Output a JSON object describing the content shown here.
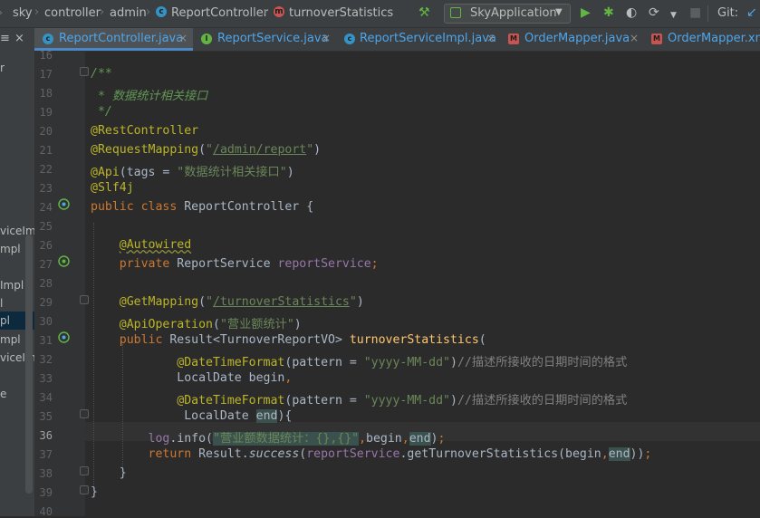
{
  "navbar": {
    "crumbs": [
      "sky",
      "controller",
      "admin",
      "ReportController",
      "turnoverStatistics"
    ],
    "run_config": "SkyApplication",
    "git_label": "Git:"
  },
  "tabs": [
    {
      "label": "ReportController.java",
      "icon": "class-icon",
      "color": "#3592c4"
    },
    {
      "label": "ReportService.java",
      "icon": "interface-icon",
      "color": "#62b543"
    },
    {
      "label": "ReportServiceImpl.java",
      "icon": "class-icon",
      "color": "#3592c4"
    },
    {
      "label": "OrderMapper.java",
      "icon": "mapper-icon",
      "color": "#c75450"
    },
    {
      "label": "OrderMapper.xm",
      "icon": "mapper-icon",
      "color": "#c75450"
    }
  ],
  "project_panel": {
    "items": [
      "r",
      "viceIm",
      "mpl",
      "Impl",
      "l",
      "pl",
      "mpl",
      "viceIm",
      "e"
    ],
    "selected_index": 5
  },
  "editor": {
    "current_line": 36,
    "lines": [
      {
        "n": "16",
        "t": [
          {
            "c": "#629755",
            "s": "",
            "i": true
          }
        ]
      },
      {
        "n": "17",
        "t": [
          {
            "c": "#629755",
            "s": "/**",
            "i": true
          }
        ]
      },
      {
        "n": "18",
        "t": [
          {
            "c": "#629755",
            "s": " * 数据统计相关接口",
            "i": true
          }
        ]
      },
      {
        "n": "19",
        "t": [
          {
            "c": "#629755",
            "s": " */",
            "i": true
          }
        ]
      },
      {
        "n": "20",
        "t": [
          {
            "c": "#bbb529",
            "s": "@RestController"
          }
        ]
      },
      {
        "n": "21",
        "t": [
          {
            "c": "#bbb529",
            "s": "@RequestMapping"
          },
          {
            "c": "#a9b7c6",
            "s": "("
          },
          {
            "c": "#6a8759",
            "s": "\""
          },
          {
            "c": "#6a8759",
            "s": "/admin/report",
            "u": true
          },
          {
            "c": "#6a8759",
            "s": "\""
          },
          {
            "c": "#a9b7c6",
            "s": ")"
          }
        ]
      },
      {
        "n": "22",
        "t": [
          {
            "c": "#bbb529",
            "s": "@Api"
          },
          {
            "c": "#a9b7c6",
            "s": "(tags = "
          },
          {
            "c": "#6a8759",
            "s": "\"数据统计相关接口\""
          },
          {
            "c": "#a9b7c6",
            "s": ")"
          }
        ]
      },
      {
        "n": "23",
        "t": [
          {
            "c": "#bbb529",
            "s": "@Slf4j"
          }
        ]
      },
      {
        "n": "24",
        "t": [
          {
            "c": "#cc7832",
            "s": "public class "
          },
          {
            "c": "#a9b7c6",
            "s": "ReportController {"
          }
        ]
      },
      {
        "n": "25",
        "t": []
      },
      {
        "n": "26",
        "t": [
          {
            "c": "#a9b7c6",
            "s": "    "
          },
          {
            "c": "#bbb529",
            "s": "@Autowired",
            "w": true
          }
        ]
      },
      {
        "n": "27",
        "t": [
          {
            "c": "#a9b7c6",
            "s": "    "
          },
          {
            "c": "#cc7832",
            "s": "private "
          },
          {
            "c": "#a9b7c6",
            "s": "ReportService "
          },
          {
            "c": "#9876aa",
            "s": "reportService"
          },
          {
            "c": "#cc7832",
            "s": ";"
          }
        ]
      },
      {
        "n": "28",
        "t": []
      },
      {
        "n": "29",
        "t": [
          {
            "c": "#a9b7c6",
            "s": "    "
          },
          {
            "c": "#bbb529",
            "s": "@GetMapping"
          },
          {
            "c": "#a9b7c6",
            "s": "("
          },
          {
            "c": "#6a8759",
            "s": "\""
          },
          {
            "c": "#6a8759",
            "s": "/turnoverStatistics",
            "u": true
          },
          {
            "c": "#6a8759",
            "s": "\""
          },
          {
            "c": "#a9b7c6",
            "s": ")"
          }
        ]
      },
      {
        "n": "30",
        "t": [
          {
            "c": "#a9b7c6",
            "s": "    "
          },
          {
            "c": "#bbb529",
            "s": "@ApiOperation"
          },
          {
            "c": "#a9b7c6",
            "s": "("
          },
          {
            "c": "#6a8759",
            "s": "\"营业额统计\""
          },
          {
            "c": "#a9b7c6",
            "s": ")"
          }
        ]
      },
      {
        "n": "31",
        "t": [
          {
            "c": "#a9b7c6",
            "s": "    "
          },
          {
            "c": "#cc7832",
            "s": "public "
          },
          {
            "c": "#a9b7c6",
            "s": "Result<TurnoverReportVO> "
          },
          {
            "c": "#ffc66d",
            "s": "turnoverStatistics"
          },
          {
            "c": "#a9b7c6",
            "s": "("
          }
        ]
      },
      {
        "n": "32",
        "t": [
          {
            "c": "#a9b7c6",
            "s": "            "
          },
          {
            "c": "#bbb529",
            "s": "@DateTimeFormat"
          },
          {
            "c": "#a9b7c6",
            "s": "(pattern = "
          },
          {
            "c": "#6a8759",
            "s": "\"yyyy-MM-dd\""
          },
          {
            "c": "#a9b7c6",
            "s": ")"
          },
          {
            "c": "#808080",
            "s": "//描述所接收的日期时间的格式"
          }
        ]
      },
      {
        "n": "33",
        "t": [
          {
            "c": "#a9b7c6",
            "s": "            LocalDate begin"
          },
          {
            "c": "#cc7832",
            "s": ","
          }
        ]
      },
      {
        "n": "34",
        "t": [
          {
            "c": "#a9b7c6",
            "s": "            "
          },
          {
            "c": "#bbb529",
            "s": "@DateTimeFormat"
          },
          {
            "c": "#a9b7c6",
            "s": "(pattern = "
          },
          {
            "c": "#6a8759",
            "s": "\"yyyy-MM-dd\""
          },
          {
            "c": "#a9b7c6",
            "s": ")"
          },
          {
            "c": "#808080",
            "s": "//描述所接收的日期时间的格式"
          }
        ]
      },
      {
        "n": "35",
        "t": [
          {
            "c": "#a9b7c6",
            "s": "             LocalDate "
          },
          {
            "c": "#a9b7c6",
            "s": "end",
            "h": true
          },
          {
            "c": "#a9b7c6",
            "s": "){"
          }
        ]
      },
      {
        "n": "36",
        "t": [
          {
            "c": "#a9b7c6",
            "s": "        "
          },
          {
            "c": "#9876aa",
            "s": "log"
          },
          {
            "c": "#a9b7c6",
            "s": ".info("
          },
          {
            "c": "#6a8759",
            "s": "\"营业额数据统计：{},{}\"",
            "h": true
          },
          {
            "c": "#cc7832",
            "s": ","
          },
          {
            "c": "#a9b7c6",
            "s": "begin"
          },
          {
            "c": "#cc7832",
            "s": ","
          },
          {
            "c": "#a9b7c6",
            "s": "end",
            "h": true
          },
          {
            "c": "#a9b7c6",
            "s": ")"
          },
          {
            "c": "#cc7832",
            "s": ";"
          }
        ]
      },
      {
        "n": "37",
        "t": [
          {
            "c": "#a9b7c6",
            "s": "        "
          },
          {
            "c": "#cc7832",
            "s": "return "
          },
          {
            "c": "#a9b7c6",
            "s": "Result."
          },
          {
            "c": "#a9b7c6",
            "s": "success",
            "i": true
          },
          {
            "c": "#a9b7c6",
            "s": "("
          },
          {
            "c": "#9876aa",
            "s": "reportService"
          },
          {
            "c": "#a9b7c6",
            "s": ".getTurnoverStatistics(begin"
          },
          {
            "c": "#cc7832",
            "s": ","
          },
          {
            "c": "#a9b7c6",
            "s": "end",
            "h": true
          },
          {
            "c": "#a9b7c6",
            "s": "))"
          },
          {
            "c": "#cc7832",
            "s": ";"
          }
        ]
      },
      {
        "n": "38",
        "t": [
          {
            "c": "#a9b7c6",
            "s": "    }"
          }
        ]
      },
      {
        "n": "39",
        "t": [
          {
            "c": "#a9b7c6",
            "s": "}"
          }
        ]
      },
      {
        "n": "40",
        "t": []
      }
    ]
  }
}
